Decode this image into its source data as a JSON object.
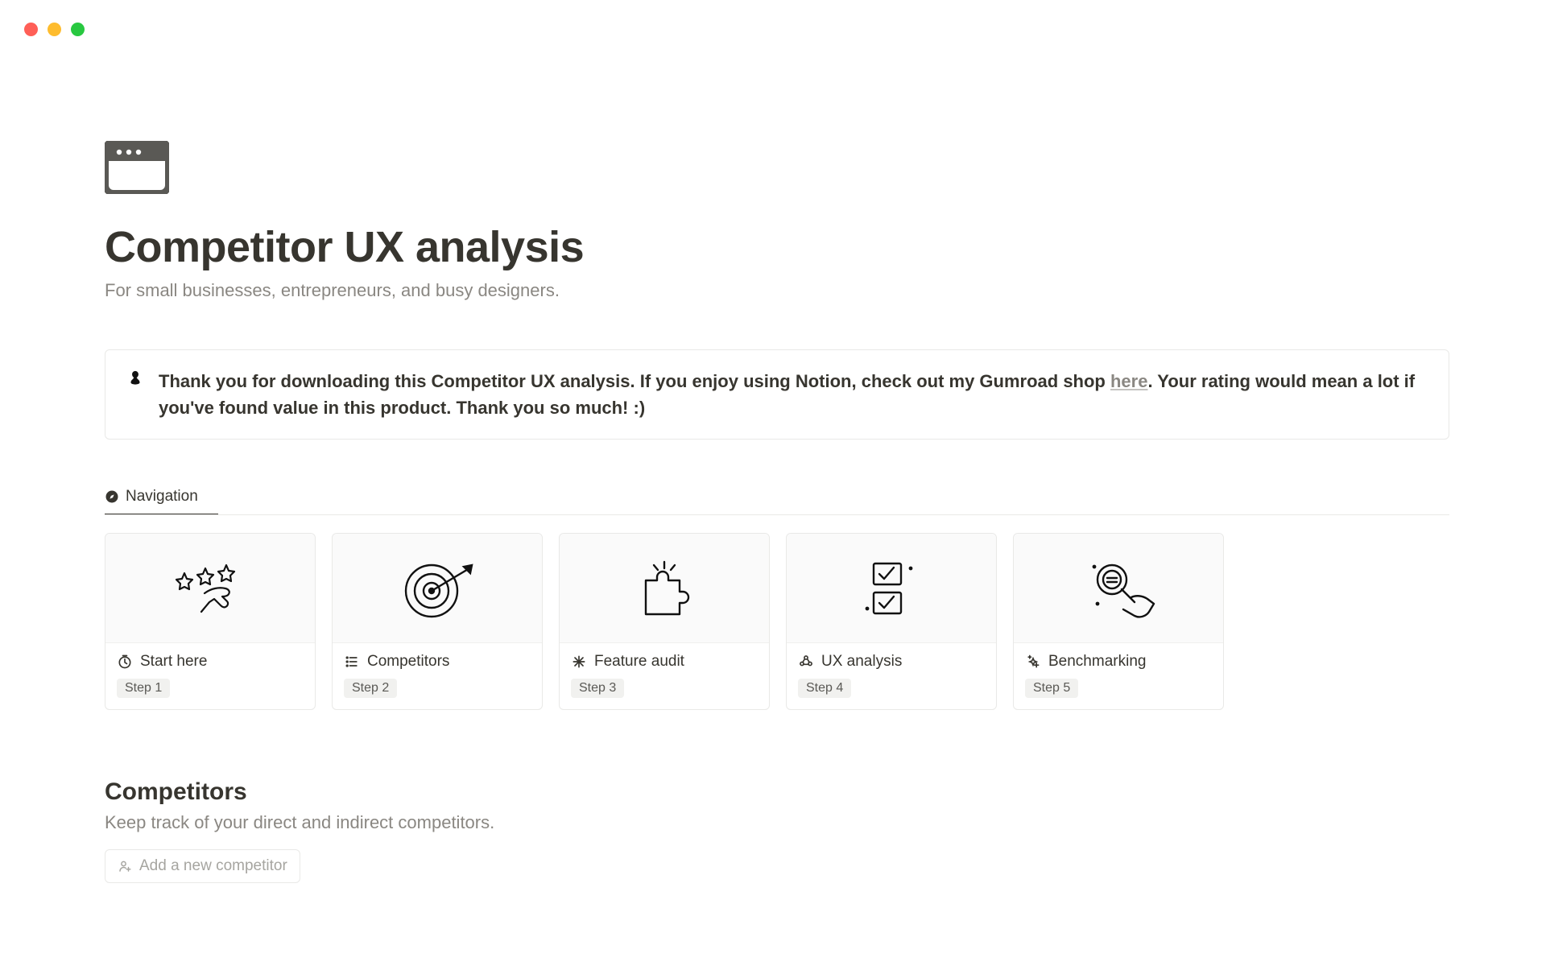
{
  "header": {
    "title": "Competitor UX analysis",
    "subtitle": "For small businesses, entrepreneurs, and busy designers."
  },
  "callout": {
    "text_before_link": "Thank you for downloading this Competitor UX analysis. If you enjoy using Notion, check out my Gumroad shop ",
    "link_text": "here",
    "text_after_link": ". Your rating would mean a lot if you've found value in this product. Thank you so much! :)"
  },
  "navigation_tab": "Navigation",
  "cards": [
    {
      "title": "Start here",
      "step": "Step 1"
    },
    {
      "title": "Competitors",
      "step": "Step 2"
    },
    {
      "title": "Feature audit",
      "step": "Step 3"
    },
    {
      "title": "UX analysis",
      "step": "Step 4"
    },
    {
      "title": "Benchmarking",
      "step": "Step 5"
    }
  ],
  "competitors": {
    "title": "Competitors",
    "subtitle": "Keep track of your direct and indirect competitors.",
    "add_button": "Add a new competitor"
  }
}
